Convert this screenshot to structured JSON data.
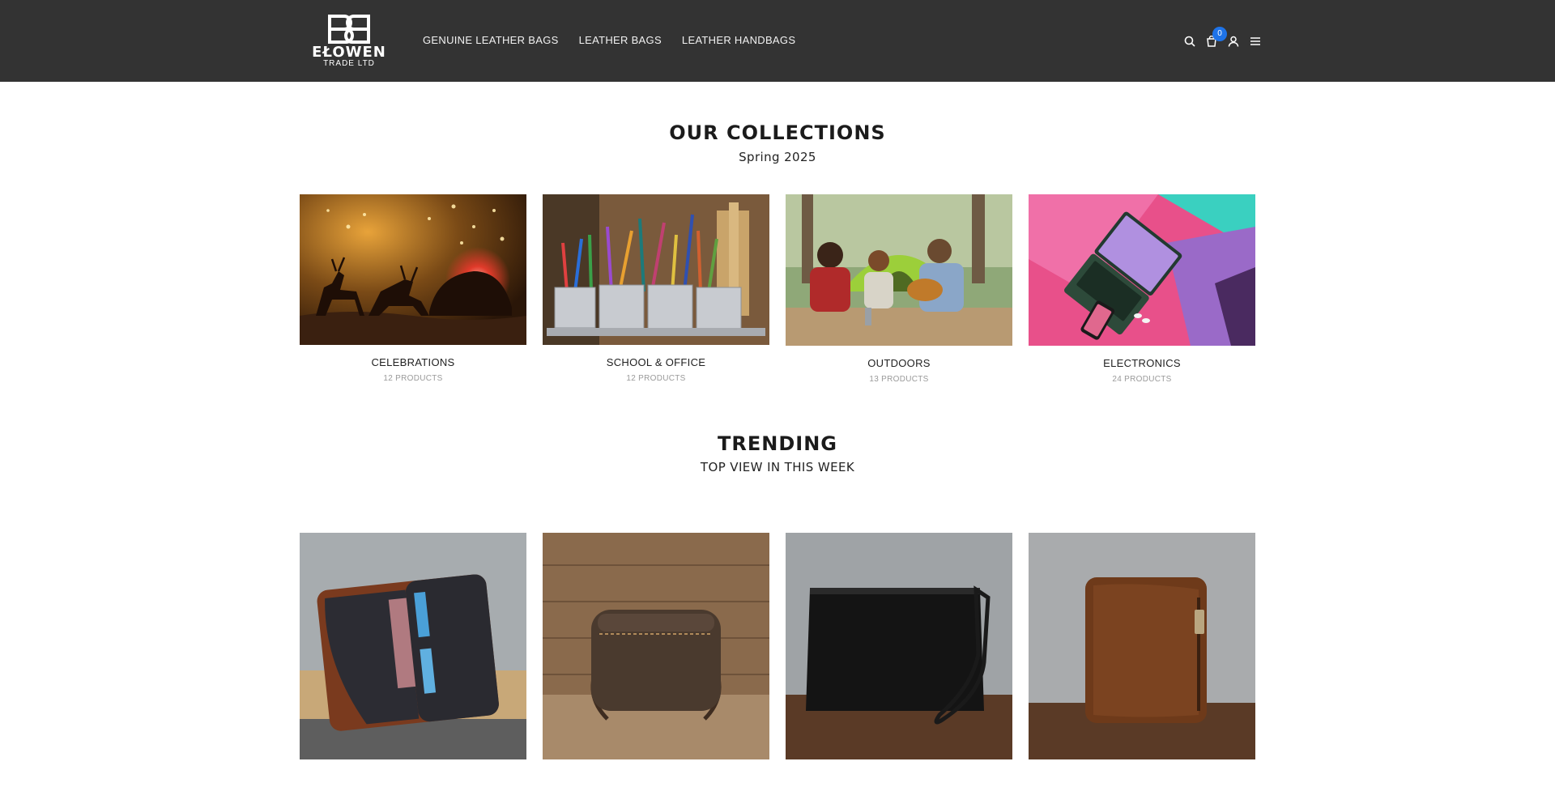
{
  "header": {
    "logo": {
      "brand": "EŁOWEN",
      "sub": "TRADE LTD"
    },
    "nav": [
      {
        "label": "GENUINE LEATHER BAGS"
      },
      {
        "label": "LEATHER BAGS"
      },
      {
        "label": "LEATHER HANDBAGS"
      }
    ],
    "icons": [
      "search-icon",
      "cart-icon",
      "user-icon",
      "menu-icon"
    ],
    "cart_count": "0"
  },
  "collections": {
    "title": "OUR COLLECTIONS",
    "subtitle": "Spring 2025",
    "items": [
      {
        "name": "CELEBRATIONS",
        "count": "12 PRODUCTS"
      },
      {
        "name": "SCHOOL & OFFICE",
        "count": "12 PRODUCTS"
      },
      {
        "name": "OUTDOORS",
        "count": "13 PRODUCTS"
      },
      {
        "name": "ELECTRONICS",
        "count": "24 PRODUCTS"
      }
    ]
  },
  "trending": {
    "title": "TRENDING",
    "subtitle": "TOP VIEW IN THIS WEEK",
    "products": [
      {
        "image": "black-leather-passport-wallet"
      },
      {
        "image": "brown-leather-crossbody-bag"
      },
      {
        "image": "black-leather-clutch-wristlet"
      },
      {
        "image": "brown-leather-zip-wallet"
      }
    ]
  }
}
